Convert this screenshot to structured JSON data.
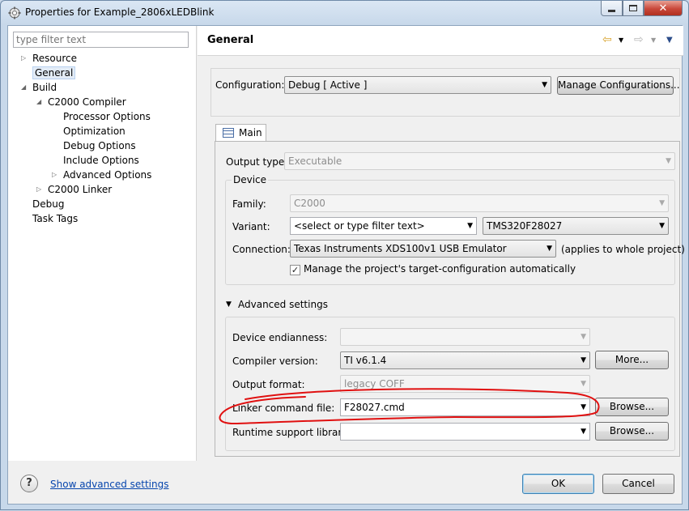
{
  "window": {
    "title": "Properties for Example_2806xLEDBlink",
    "min_icon": "minimize-icon",
    "max_icon": "maximize-icon",
    "close_icon": "close-icon"
  },
  "tree": {
    "filter_placeholder": "type filter text",
    "items": [
      {
        "label": "Resource"
      },
      {
        "label": "General"
      },
      {
        "label": "Build"
      },
      {
        "label": "C2000 Compiler"
      },
      {
        "label": "Processor Options"
      },
      {
        "label": "Optimization"
      },
      {
        "label": "Debug Options"
      },
      {
        "label": "Include Options"
      },
      {
        "label": "Advanced Options"
      },
      {
        "label": "C2000 Linker"
      },
      {
        "label": "Debug"
      },
      {
        "label": "Task Tags"
      }
    ]
  },
  "page": {
    "title": "General",
    "configuration_label": "Configuration:",
    "configuration_value": "Debug  [ Active ]",
    "manage_configurations": "Manage Configurations...",
    "tab_main": "Main",
    "output_type_label": "Output type:",
    "output_type_value": "Executable",
    "device_group": "Device",
    "family_label": "Family:",
    "family_value": "C2000",
    "variant_label": "Variant:",
    "variant_filter": "<select or type filter text>",
    "variant_value": "TMS320F28027",
    "connection_label": "Connection:",
    "connection_value": "Texas Instruments XDS100v1 USB Emulator",
    "connection_note": "(applies to whole project)",
    "manage_target_label": "Manage the project's target-configuration automatically",
    "manage_target_checked": "✓",
    "advanced_title": "Advanced settings",
    "endianness_label": "Device endianness:",
    "endianness_value": "",
    "compiler_version_label": "Compiler version:",
    "compiler_version_value": "TI v6.1.4",
    "more_button": "More...",
    "output_format_label": "Output format:",
    "output_format_value": "legacy COFF",
    "linker_cmd_label": "Linker command file:",
    "linker_cmd_value": "F28027.cmd",
    "browse_button_1": "Browse...",
    "runtime_lib_label": "Runtime support library:",
    "runtime_lib_value": "",
    "browse_button_2": "Browse..."
  },
  "footer": {
    "help_glyph": "?",
    "show_advanced": "Show advanced settings",
    "ok": "OK",
    "cancel": "Cancel"
  },
  "colors": {
    "annotation": "#e01010",
    "link": "#0645ad"
  }
}
